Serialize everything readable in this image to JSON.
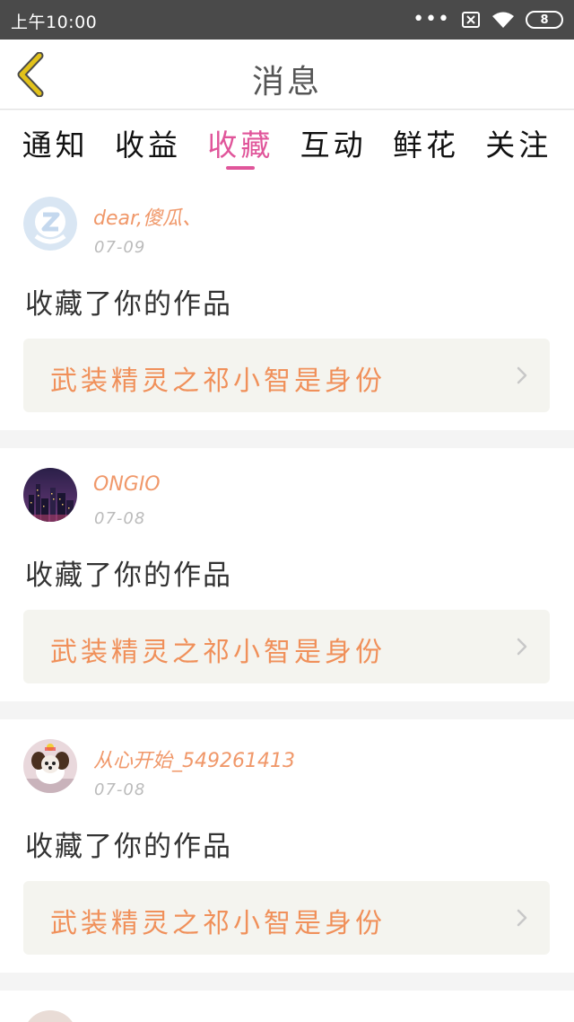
{
  "status_bar": {
    "time": "上午10:00",
    "dots": "•••",
    "battery_level": "8",
    "icons": [
      "signal-dots-icon",
      "sim-off-icon",
      "wifi-icon",
      "battery-icon"
    ]
  },
  "header": {
    "title": "消息",
    "back_icon": "chevron-left-icon"
  },
  "tabs": [
    {
      "label": "通知",
      "active": false
    },
    {
      "label": "收益",
      "active": false
    },
    {
      "label": "收藏",
      "active": true
    },
    {
      "label": "互动",
      "active": false
    },
    {
      "label": "鲜花",
      "active": false
    },
    {
      "label": "关注",
      "active": false
    }
  ],
  "messages": [
    {
      "user": "dear,傻瓜、",
      "date": "07-09",
      "action": "收藏了你的作品",
      "work_title": "武装精灵之祁小智是身份",
      "avatar": "default-avatar-icon"
    },
    {
      "user": "ONGIO",
      "date": "07-08",
      "action": "收藏了你的作品",
      "work_title": "武装精灵之祁小智是身份",
      "avatar": "city-night-photo"
    },
    {
      "user": "从心开始_549261413",
      "date": "07-08",
      "action": "收藏了你的作品",
      "work_title": "武装精灵之祁小智是身份",
      "avatar": "puppy-photo"
    }
  ],
  "colors": {
    "accent_pink": "#e0559a",
    "username_orange": "#f0986a",
    "work_title_orange": "#f0905a",
    "back_icon_yellow": "#e2c21a",
    "status_bar_bg": "#4a4a4a"
  }
}
